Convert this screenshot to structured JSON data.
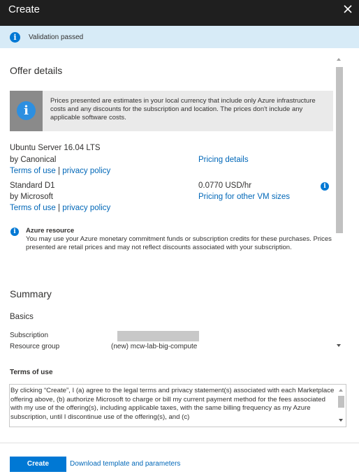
{
  "header": {
    "title": "Create",
    "close_icon": "close-icon"
  },
  "validation": {
    "icon": "info-icon",
    "text": "Validation passed"
  },
  "offer_details": {
    "title": "Offer details",
    "notice_icon": "info-icon",
    "notice_text": "Prices presented are estimates in your local currency that include only Azure infrastructure costs and any discounts for the subscription and location. The prices don't include any applicable software costs.",
    "items": [
      {
        "name": "Ubuntu Server 16.04 LTS",
        "publisher": "by Canonical",
        "terms_link": "Terms of use",
        "separator": "|",
        "privacy_link": "privacy policy",
        "pricing_link": "Pricing details"
      },
      {
        "name": "Standard D1",
        "publisher": "by Microsoft",
        "terms_link": "Terms of use",
        "separator": "|",
        "privacy_link": "privacy policy",
        "price": "0.0770 USD/hr",
        "pricing_link": "Pricing for other VM sizes"
      }
    ],
    "azure_resource": {
      "icon": "info-icon",
      "title": "Azure resource",
      "text": "You may use your Azure monetary commitment funds or subscription credits for these purchases. Prices presented are retail prices and may not reflect discounts associated with your subscription."
    }
  },
  "summary": {
    "title": "Summary",
    "basics_label": "Basics",
    "rows": [
      {
        "label": "Subscription",
        "value": ""
      },
      {
        "label": "Resource group",
        "value": "(new) mcw-lab-big-compute"
      }
    ]
  },
  "terms": {
    "title": "Terms of use",
    "text": "By clicking “Create”, I (a) agree to the legal terms and privacy statement(s) associated with each Marketplace offering above, (b) authorize Microsoft to charge or bill my current payment method for the fees associated with my use of the offering(s), including applicable taxes, with the same billing frequency as my Azure subscription, until I discontinue use of the offering(s), and (c)"
  },
  "footer": {
    "create_label": "Create",
    "download_link": "Download template and parameters"
  },
  "colors": {
    "header_bg": "#1f1f1f",
    "validation_bg": "#d7ebf7",
    "accent": "#0078d4",
    "link": "#0067b8"
  }
}
